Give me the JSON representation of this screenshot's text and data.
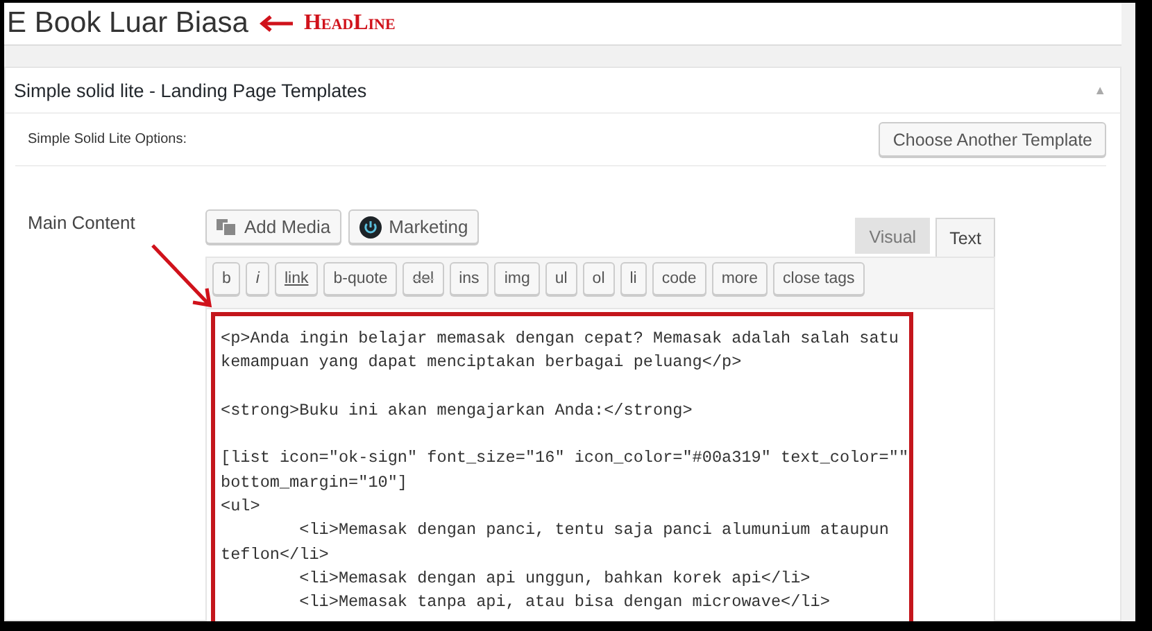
{
  "title": {
    "value": "E Book Luar Biasa"
  },
  "headline_annotation": {
    "label": "HeadLine"
  },
  "panel": {
    "title": "Simple solid lite - Landing Page Templates",
    "toggle": "▲",
    "expanded": true
  },
  "options_label": "Simple Solid Lite Options:",
  "template_button": {
    "label": "Choose Another Template"
  },
  "field_label": "Main Content",
  "media_buttons": [
    {
      "kind": "media",
      "label": "Add Media"
    },
    {
      "kind": "marketing",
      "label": "Marketing"
    }
  ],
  "editor_tabs": [
    {
      "label": "Visual",
      "selected": false
    },
    {
      "label": "Text",
      "selected": true
    }
  ],
  "quicktags": [
    {
      "label": "b",
      "kind": "plain"
    },
    {
      "label": "i",
      "kind": "italic"
    },
    {
      "label": "link",
      "kind": "underline"
    },
    {
      "label": "b-quote",
      "kind": "plain"
    },
    {
      "label": "del",
      "kind": "strike"
    },
    {
      "label": "ins",
      "kind": "plain"
    },
    {
      "label": "img",
      "kind": "plain"
    },
    {
      "label": "ul",
      "kind": "plain"
    },
    {
      "label": "ol",
      "kind": "plain"
    },
    {
      "label": "li",
      "kind": "plain"
    },
    {
      "label": "code",
      "kind": "plain"
    },
    {
      "label": "more",
      "kind": "plain"
    },
    {
      "label": "close tags",
      "kind": "plain"
    }
  ],
  "content": {
    "highlighted": true,
    "text": "<p>Anda ingin belajar memasak dengan cepat? Memasak adalah salah satu\nkemampuan yang dapat menciptakan berbagai peluang</p>\n\n<strong>Buku ini akan mengajarkan Anda:</strong>\n\n[list icon=\"ok-sign\" font_size=\"16\" icon_color=\"#00a319\" text_color=\"\"\nbottom_margin=\"10\"]\n<ul>\n\t<li>Memasak dengan panci, tentu saja panci alumunium ataupun\nteflon</li>\n\t<li>Memasak dengan api unggun, bahkan korek api</li>\n\t<li>Memasak tanpa api, atau bisa dengan microwave</li>"
  }
}
